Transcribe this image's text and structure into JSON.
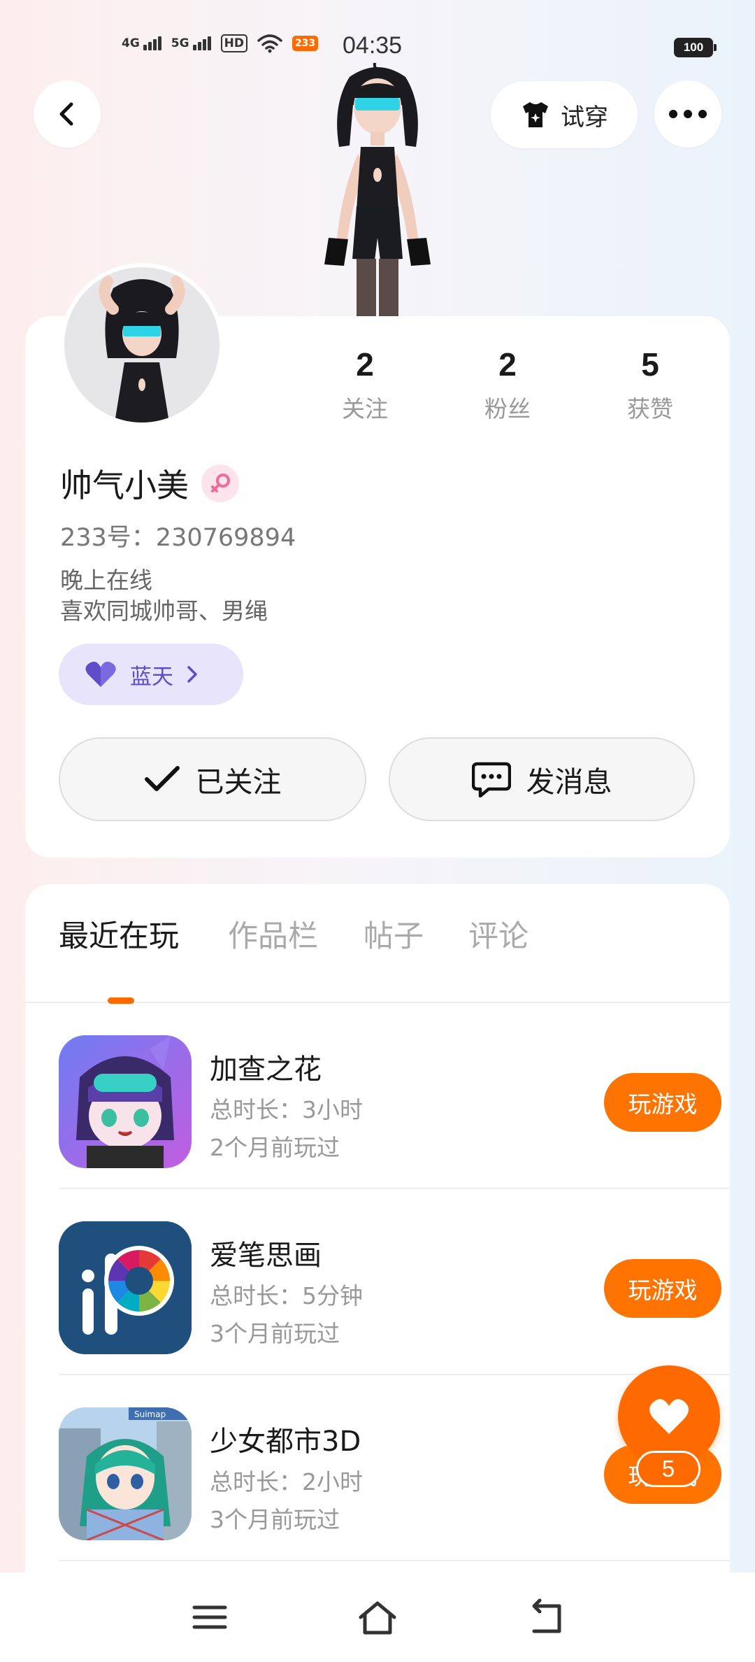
{
  "status_bar": {
    "signal_1": "4G",
    "signal_2": "5G",
    "hd_label": "HD",
    "notification_badge": "233",
    "time": "04:35",
    "battery": "100"
  },
  "header": {
    "try_on_label": "试穿"
  },
  "profile": {
    "username": "帅气小美",
    "uid": "233号：230769894",
    "bio_line_1": "晚上在线",
    "bio_line_2": "喜欢同城帅哥、男绳",
    "tag_label": "蓝天",
    "stats": [
      {
        "value": "2",
        "label": "关注"
      },
      {
        "value": "2",
        "label": "粉丝"
      },
      {
        "value": "5",
        "label": "获赞"
      }
    ],
    "follow_label": "已关注",
    "message_label": "发消息"
  },
  "tabs": [
    {
      "label": "最近在玩",
      "active": true
    },
    {
      "label": "作品栏",
      "active": false
    },
    {
      "label": "帖子",
      "active": false
    },
    {
      "label": "评论",
      "active": false
    }
  ],
  "games": [
    {
      "name": "加查之花",
      "duration": "总时长：3小时",
      "last_played": "2个月前玩过",
      "button": "玩游戏",
      "icon": "gacha-flower-icon"
    },
    {
      "name": "爱笔思画",
      "duration": "总时长：5分钟",
      "last_played": "3个月前玩过",
      "button": "玩游戏",
      "icon": "ibis-paint-icon"
    },
    {
      "name": "少女都市3D",
      "duration": "总时长：2小时",
      "last_played": "3个月前玩过",
      "button": "玩游戏",
      "icon": "girl-city-3d-icon",
      "icon_banner_text": "Suimap"
    }
  ],
  "like_fab": {
    "count": "5"
  },
  "colors": {
    "accent": "#ff7300",
    "tag_bg": "#e8e4fb",
    "tag_text": "#5e4cc9"
  }
}
